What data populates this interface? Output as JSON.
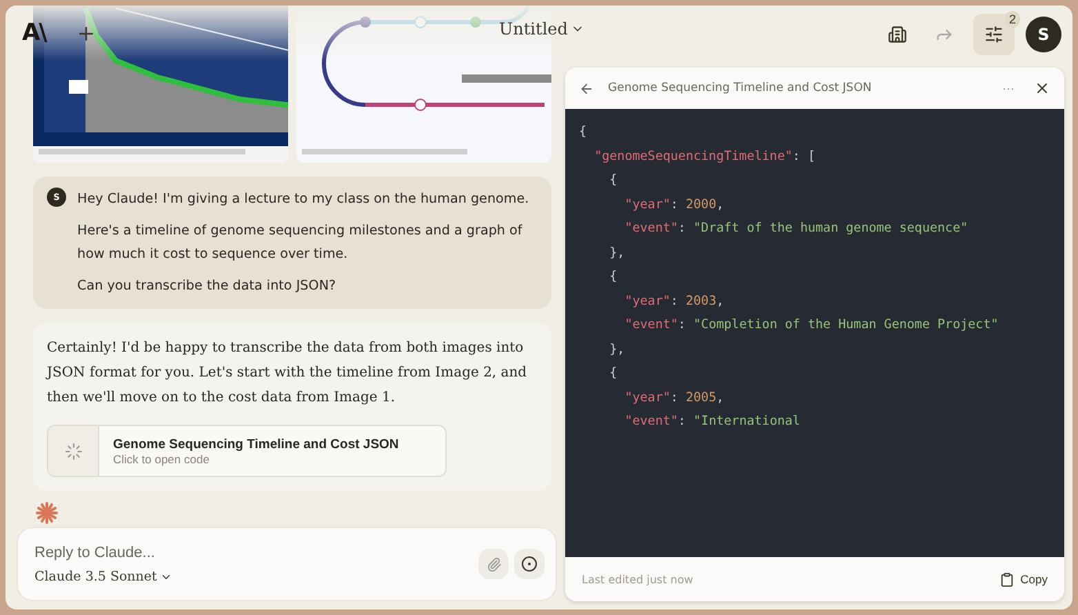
{
  "header": {
    "logo": "A\\",
    "title": "Untitled",
    "badge": "2",
    "avatar": "S"
  },
  "user_message": {
    "avatar": "S",
    "paragraphs": [
      "Hey Claude! I'm giving a lecture to my class on the human genome.",
      "Here's a timeline of genome sequencing milestones and a graph of how much it cost to sequence over time.",
      "Can you transcribe the data into JSON?"
    ]
  },
  "assistant_message": {
    "text": "Certainly! I'd be happy to transcribe the data from both images into JSON format for you. Let's start with the timeline from Image 2, and then we'll move on to the cost data from Image 1.",
    "artifact": {
      "title": "Genome Sequencing Timeline and Cost JSON",
      "subtitle": "Click to open code",
      "loading": true
    },
    "thinking": true
  },
  "composer": {
    "placeholder": "Reply to Claude...",
    "model": "Claude 3.5 Sonnet"
  },
  "artifact_panel": {
    "title": "Genome Sequencing Timeline and Cost JSON",
    "more": "···",
    "footer": "Last edited just now",
    "copy": "Copy",
    "code": [
      [
        {
          "kind": "punct",
          "text": "{"
        }
      ],
      [
        {
          "kind": "key",
          "text": "  \"genomeSequencingTimeline\""
        },
        {
          "kind": "punct",
          "text": ": ["
        }
      ],
      [
        {
          "kind": "punct",
          "text": "    {"
        }
      ],
      [
        {
          "kind": "key",
          "text": "      \"year\""
        },
        {
          "kind": "punct",
          "text": ": "
        },
        {
          "kind": "number",
          "text": "2000"
        },
        {
          "kind": "punct",
          "text": ","
        }
      ],
      [
        {
          "kind": "key",
          "text": "      \"event\""
        },
        {
          "kind": "punct",
          "text": ": "
        },
        {
          "kind": "string",
          "text": "\"Draft of the human genome sequence\""
        }
      ],
      [
        {
          "kind": "punct",
          "text": "    },"
        }
      ],
      [
        {
          "kind": "punct",
          "text": "    {"
        }
      ],
      [
        {
          "kind": "key",
          "text": "      \"year\""
        },
        {
          "kind": "punct",
          "text": ": "
        },
        {
          "kind": "number",
          "text": "2003"
        },
        {
          "kind": "punct",
          "text": ","
        }
      ],
      [
        {
          "kind": "key",
          "text": "      \"event\""
        },
        {
          "kind": "punct",
          "text": ": "
        },
        {
          "kind": "string",
          "text": "\"Completion of the Human Genome Project\""
        }
      ],
      [
        {
          "kind": "punct",
          "text": "    },"
        }
      ],
      [
        {
          "kind": "punct",
          "text": "    {"
        }
      ],
      [
        {
          "kind": "key",
          "text": "      \"year\""
        },
        {
          "kind": "punct",
          "text": ": "
        },
        {
          "kind": "number",
          "text": "2005"
        },
        {
          "kind": "punct",
          "text": ","
        }
      ],
      [
        {
          "kind": "key",
          "text": "      \"event\""
        },
        {
          "kind": "punct",
          "text": ": "
        },
        {
          "kind": "string",
          "text": "\"International"
        }
      ]
    ]
  }
}
